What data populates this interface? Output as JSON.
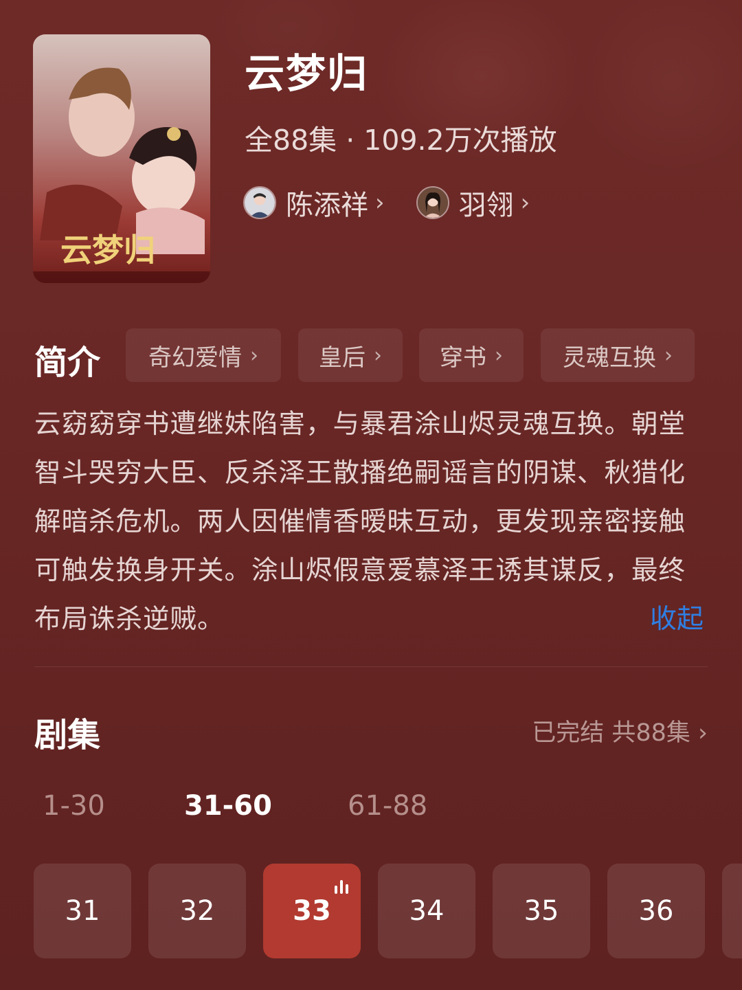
{
  "show": {
    "title": "云梦归",
    "meta": "全88集 · 109.2万次播放",
    "poster_title_art": "云梦归"
  },
  "cast": [
    {
      "name": "陈添祥"
    },
    {
      "name": "羽翎"
    }
  ],
  "intro": {
    "label": "简介",
    "tags": [
      "奇幻爱情",
      "皇后",
      "穿书",
      "灵魂互换"
    ],
    "description": "云窈窈穿书遭继妹陷害，与暴君涂山烬灵魂互换。朝堂智斗哭穷大臣、反杀泽王散播绝嗣谣言的阴谋、秋猎化解暗杀危机。两人因催情香暧昧互动，更发现亲密接触可触发换身开关。涂山烬假意爱慕泽王诱其谋反，最终布局诛杀逆贼。",
    "collapse_label": "收起"
  },
  "episodes": {
    "label": "剧集",
    "status": "已完结 共88集",
    "ranges": [
      "1-30",
      "31-60",
      "61-88"
    ],
    "active_range": "31-60",
    "items": [
      "31",
      "32",
      "33",
      "34",
      "35",
      "36"
    ],
    "playing": "33"
  },
  "colors": {
    "accent_blue": "#2f7fe2",
    "playing_red": "#b23a30"
  }
}
